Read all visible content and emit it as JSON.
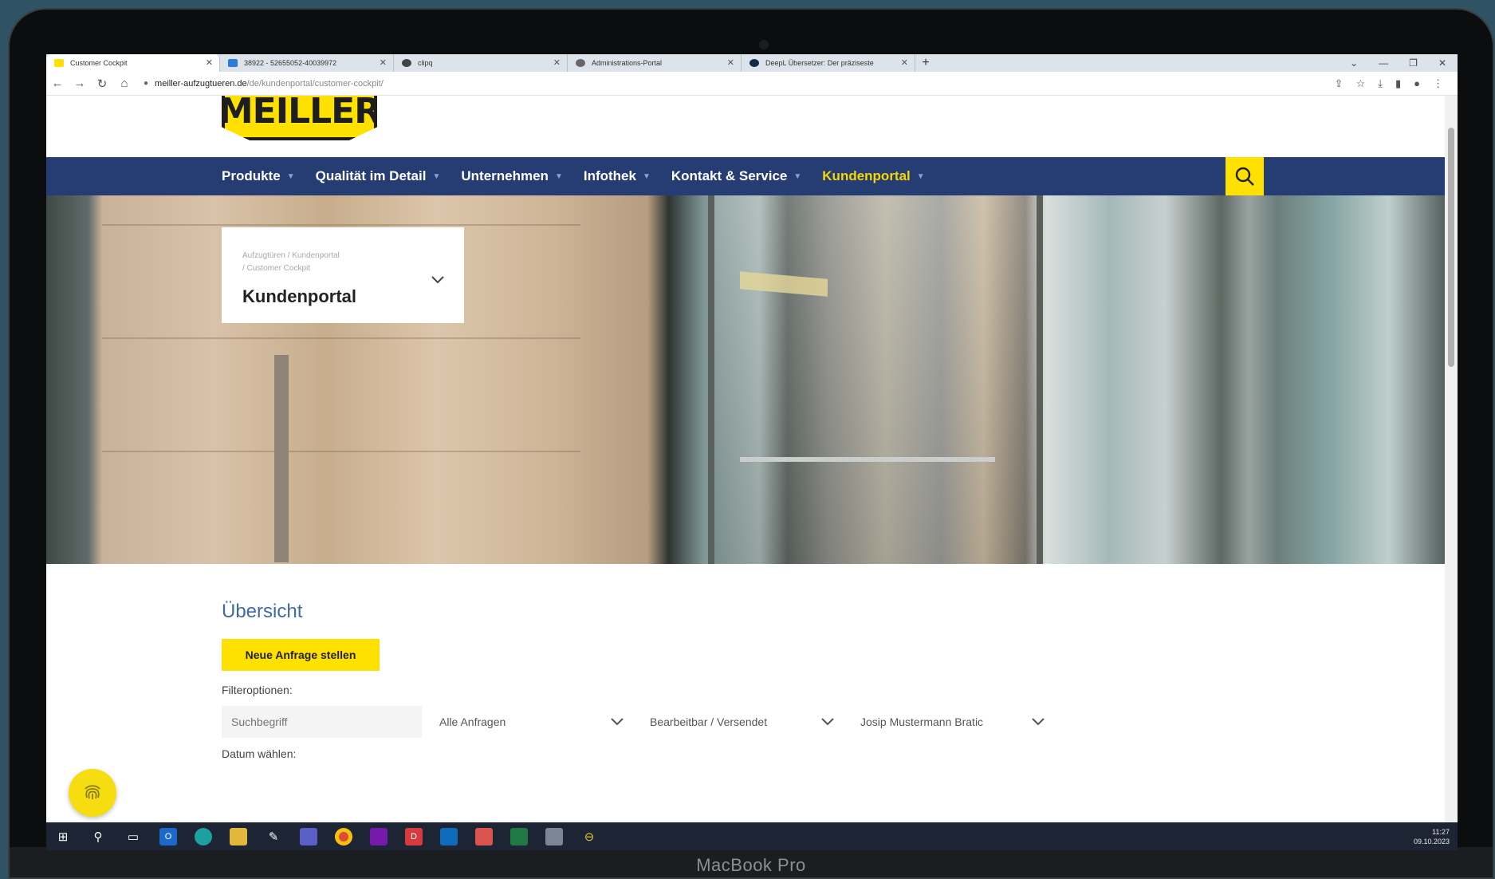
{
  "device": {
    "label": "MacBook Pro"
  },
  "browser": {
    "tabs": [
      {
        "label": "Customer Cockpit",
        "favicon_color": "#ffe100"
      },
      {
        "label": "38922 - 52655052-40039972",
        "favicon_color": "#2f7bd6"
      },
      {
        "label": "clipq",
        "favicon_color": "#444444"
      },
      {
        "label": "Administrations-Portal",
        "favicon_color": "#666666"
      },
      {
        "label": "DeepL Übersetzer: Der präziseste",
        "favicon_color": "#0f2b46"
      }
    ],
    "new_tab": "+",
    "url": {
      "host": "meiller-aufzugtueren.de",
      "path": "/de/kundenportal/customer-cockpit/"
    }
  },
  "site": {
    "logo_text": "MEILLER",
    "nav": [
      {
        "label": "Produkte",
        "active": false
      },
      {
        "label": "Qualität im Detail",
        "active": false
      },
      {
        "label": "Unternehmen",
        "active": false
      },
      {
        "label": "Infothek",
        "active": false
      },
      {
        "label": "Kontakt & Service",
        "active": false
      },
      {
        "label": "Kundenportal",
        "active": true
      }
    ],
    "search_icon": "search-icon"
  },
  "hero": {
    "breadcrumb_line1": "Aufzugtüren / Kundenportal",
    "breadcrumb_line2": "/ Customer Cockpit",
    "title": "Kundenportal"
  },
  "main": {
    "heading": "Übersicht",
    "new_request_button": "Neue Anfrage stellen",
    "filter_label": "Filteroptionen:",
    "search_placeholder": "Suchbegriff",
    "filters": [
      {
        "value": "Alle Anfragen"
      },
      {
        "value": "Bearbeitbar / Versendet"
      },
      {
        "value": "Josip Mustermann Bratic"
      }
    ],
    "date_label": "Datum wählen:"
  },
  "taskbar": {
    "time": "11:27",
    "date": "09.10.2023"
  },
  "colors": {
    "nav_bg": "#253d73",
    "accent_yellow": "#ffe100",
    "heading_blue": "#3f6aa7"
  }
}
